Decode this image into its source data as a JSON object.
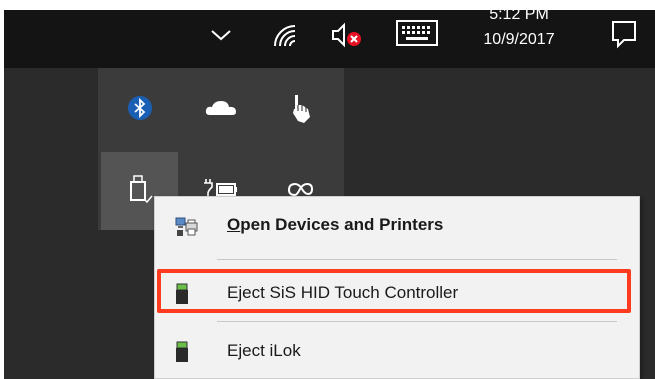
{
  "taskbar": {
    "icons": [
      "chevron-up-icon",
      "wifi-icon",
      "volume-muted-icon",
      "keyboard-icon",
      "notification-icon"
    ],
    "clock_time": "5:12 PM",
    "clock_date": "10/9/2017"
  },
  "tray": {
    "icons": [
      "bluetooth-icon",
      "onedrive-cloud-icon",
      "pen-touch-icon",
      "usb-drive-eject-icon",
      "power-battery-icon",
      "creative-cloud-icon"
    ]
  },
  "context_menu": {
    "items": [
      {
        "label_prefix": "O",
        "label_rest": "pen Devices and Printers",
        "icon": "devices-printers-icon"
      },
      {
        "label": "Eject SiS HID Touch Controller",
        "icon": "usb-device-icon",
        "highlighted": true
      },
      {
        "label": "Eject iLok",
        "icon": "usb-device-icon"
      }
    ]
  },
  "colors": {
    "taskbar": "#141414",
    "tray": "#3b3b3b",
    "menu": "#f2f2f2",
    "highlight": "#ff3b1f",
    "bluetooth": "#1a5fb4"
  }
}
